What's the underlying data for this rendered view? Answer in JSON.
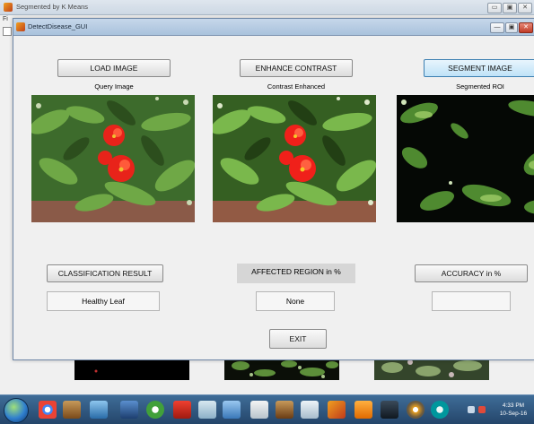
{
  "outer_window": {
    "title": "Segmented by K Means",
    "menu_letter": "Fi",
    "controls": [
      "▭",
      "▣",
      "✕"
    ]
  },
  "dialog": {
    "title": "DetectDisease_GUI",
    "controls": [
      "—",
      "▣",
      "✕"
    ]
  },
  "buttons": {
    "load_image": "LOAD IMAGE",
    "enhance_contrast": "ENHANCE CONTRAST",
    "segment_image": "SEGMENT IMAGE",
    "classification_result": "CLASSIFICATION RESULT",
    "accuracy": "ACCURACY in %",
    "exit": "EXIT"
  },
  "captions": {
    "query": "Query Image",
    "enhanced": "Contrast Enhanced",
    "segmented": "Segmented ROI"
  },
  "affected_region_label": "AFFECTED REGION in %",
  "fields": {
    "classification_value": "Healthy Leaf",
    "affected_region_value": "None",
    "accuracy_value": ""
  },
  "colors": {
    "accent_button": "#bfe2f7",
    "flower": "#e8231a",
    "leaf": "#3f8a2a",
    "taskbar": "#24456a"
  },
  "taskbar": {
    "icons": [
      "start-orb-icon",
      "chrome-icon",
      "package-icon",
      "network-icon",
      "photo-icon",
      "torrent-icon",
      "pdf-icon",
      "pen-icon",
      "note-icon",
      "document-icon",
      "box-icon",
      "notepad-icon",
      "matlab-icon",
      "vlc-icon",
      "p-icon",
      "gimp-icon",
      "arduino-icon"
    ],
    "time": "4:33 PM",
    "date": "10-Sep-16"
  }
}
